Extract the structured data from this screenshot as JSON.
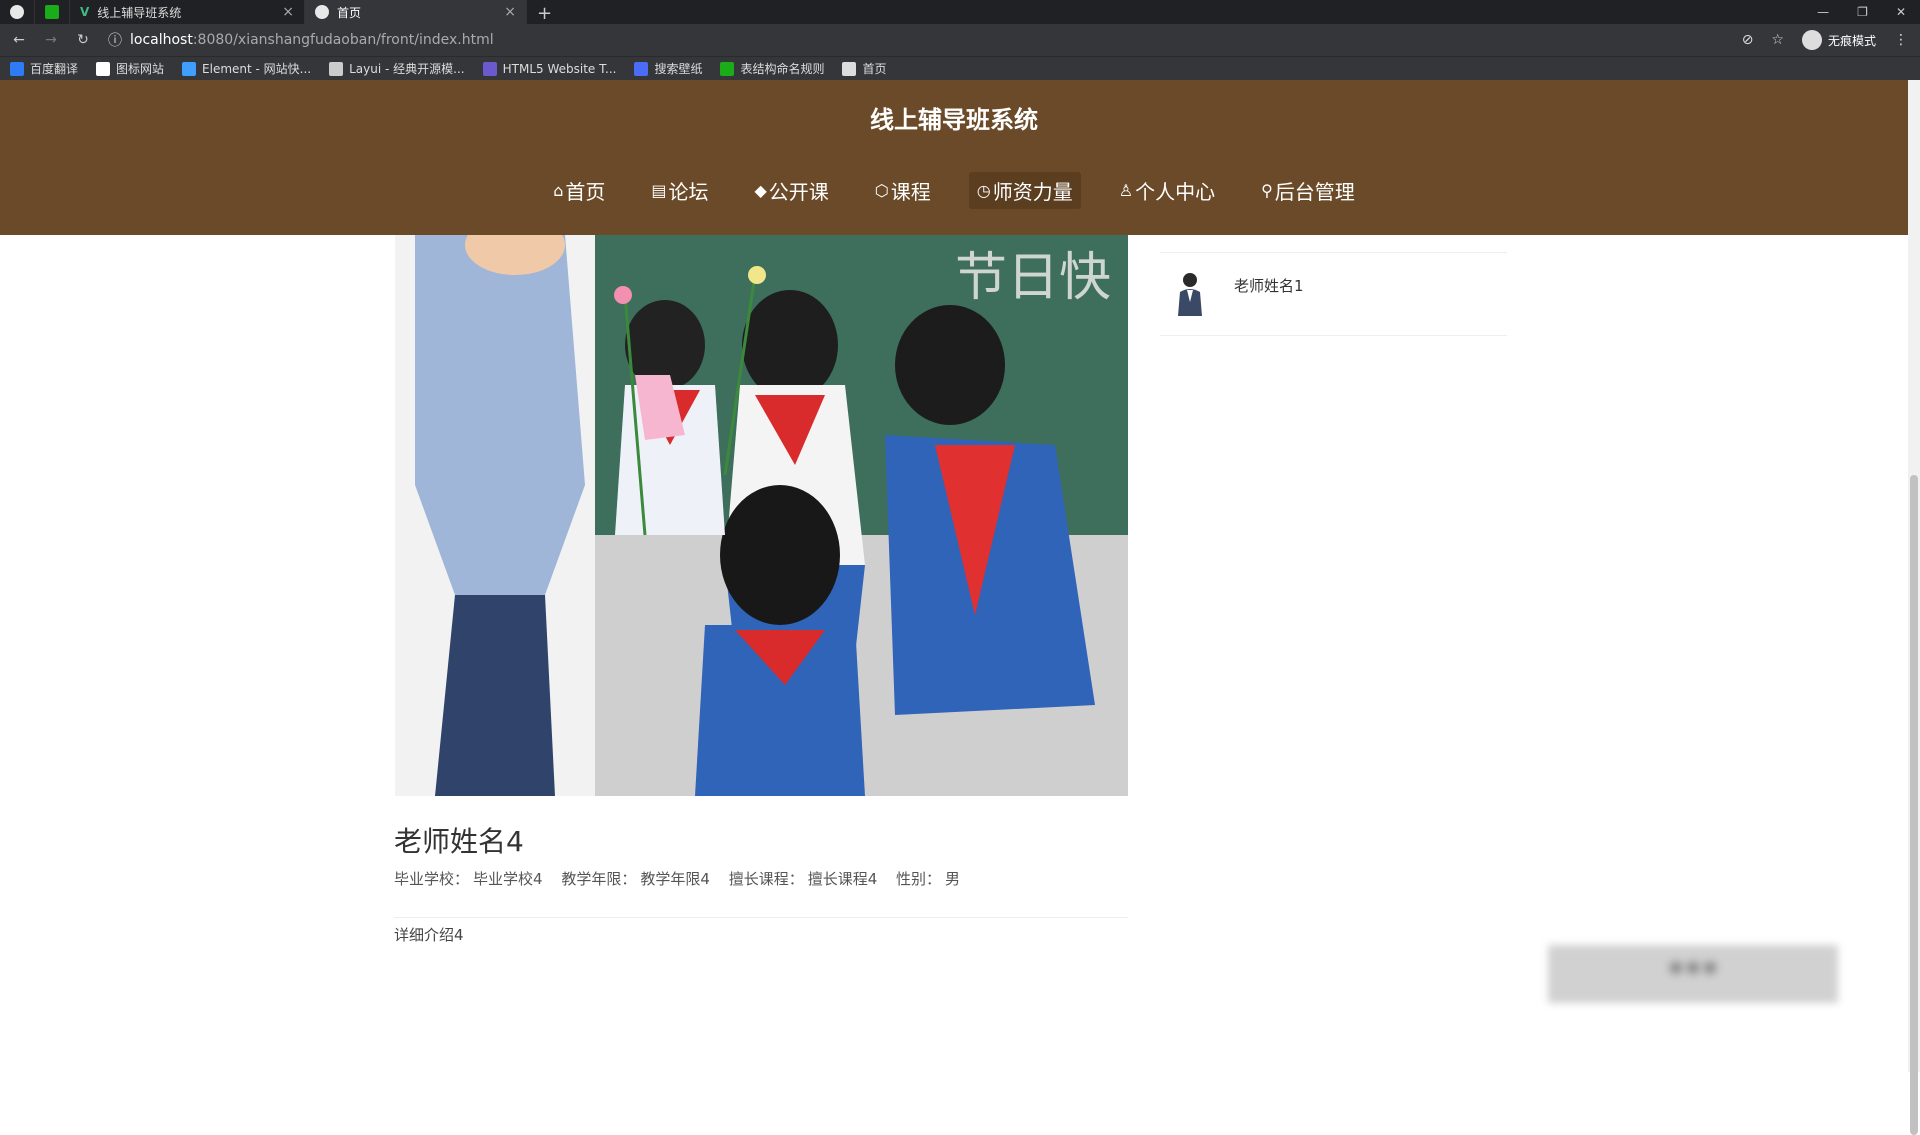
{
  "browser": {
    "tabs": [
      {
        "label": "",
        "icon": "chrome-icon"
      },
      {
        "label": "",
        "icon": "green-app-icon"
      },
      {
        "label": "线上辅导班系统",
        "icon": "vue-icon"
      },
      {
        "label": "首页",
        "icon": "globe-icon",
        "active": true
      }
    ],
    "new_tab": "+",
    "url_host": "localhost",
    "url_path": ":8080/xianshangfudaoban/front/index.html",
    "incognito_label": "无痕模式",
    "bookmarks": [
      {
        "label": "百度翻译",
        "color": "#2f7bf6"
      },
      {
        "label": "图标网站",
        "color": "#ffffff"
      },
      {
        "label": "Element - 网站快...",
        "color": "#409eff"
      },
      {
        "label": "Layui - 经典开源模...",
        "color": "#cccccc"
      },
      {
        "label": "HTML5 Website T...",
        "color": "#6a5acd"
      },
      {
        "label": "搜索壁纸",
        "color": "#4a6cf7"
      },
      {
        "label": "表结构命名规则",
        "color": "#1aad19"
      },
      {
        "label": "首页",
        "color": "#dddddd"
      }
    ]
  },
  "site": {
    "title": "线上辅导班系统",
    "nav": [
      {
        "label": "首页",
        "icon": "⌂"
      },
      {
        "label": "论坛",
        "icon": "▤"
      },
      {
        "label": "公开课",
        "icon": "◆"
      },
      {
        "label": "课程",
        "icon": "⬡"
      },
      {
        "label": "师资力量",
        "icon": "◷",
        "active": true
      },
      {
        "label": "个人中心",
        "icon": "♙"
      },
      {
        "label": "后台管理",
        "icon": "⚲"
      }
    ],
    "header_color": "#6a4a28"
  },
  "teacher": {
    "name": "老师姓名4",
    "meta": {
      "school_label": "毕业学校：",
      "school": "毕业学校4",
      "years_label": "教学年限：",
      "years": "教学年限4",
      "course_label": "擅长课程：",
      "course": "擅长课程4",
      "gender_label": "性别：",
      "gender": "男"
    },
    "detail": "详细介绍4"
  },
  "sidebar": {
    "items": [
      {
        "name": "老师姓名1"
      }
    ]
  },
  "overlay": {
    "text": "***"
  }
}
